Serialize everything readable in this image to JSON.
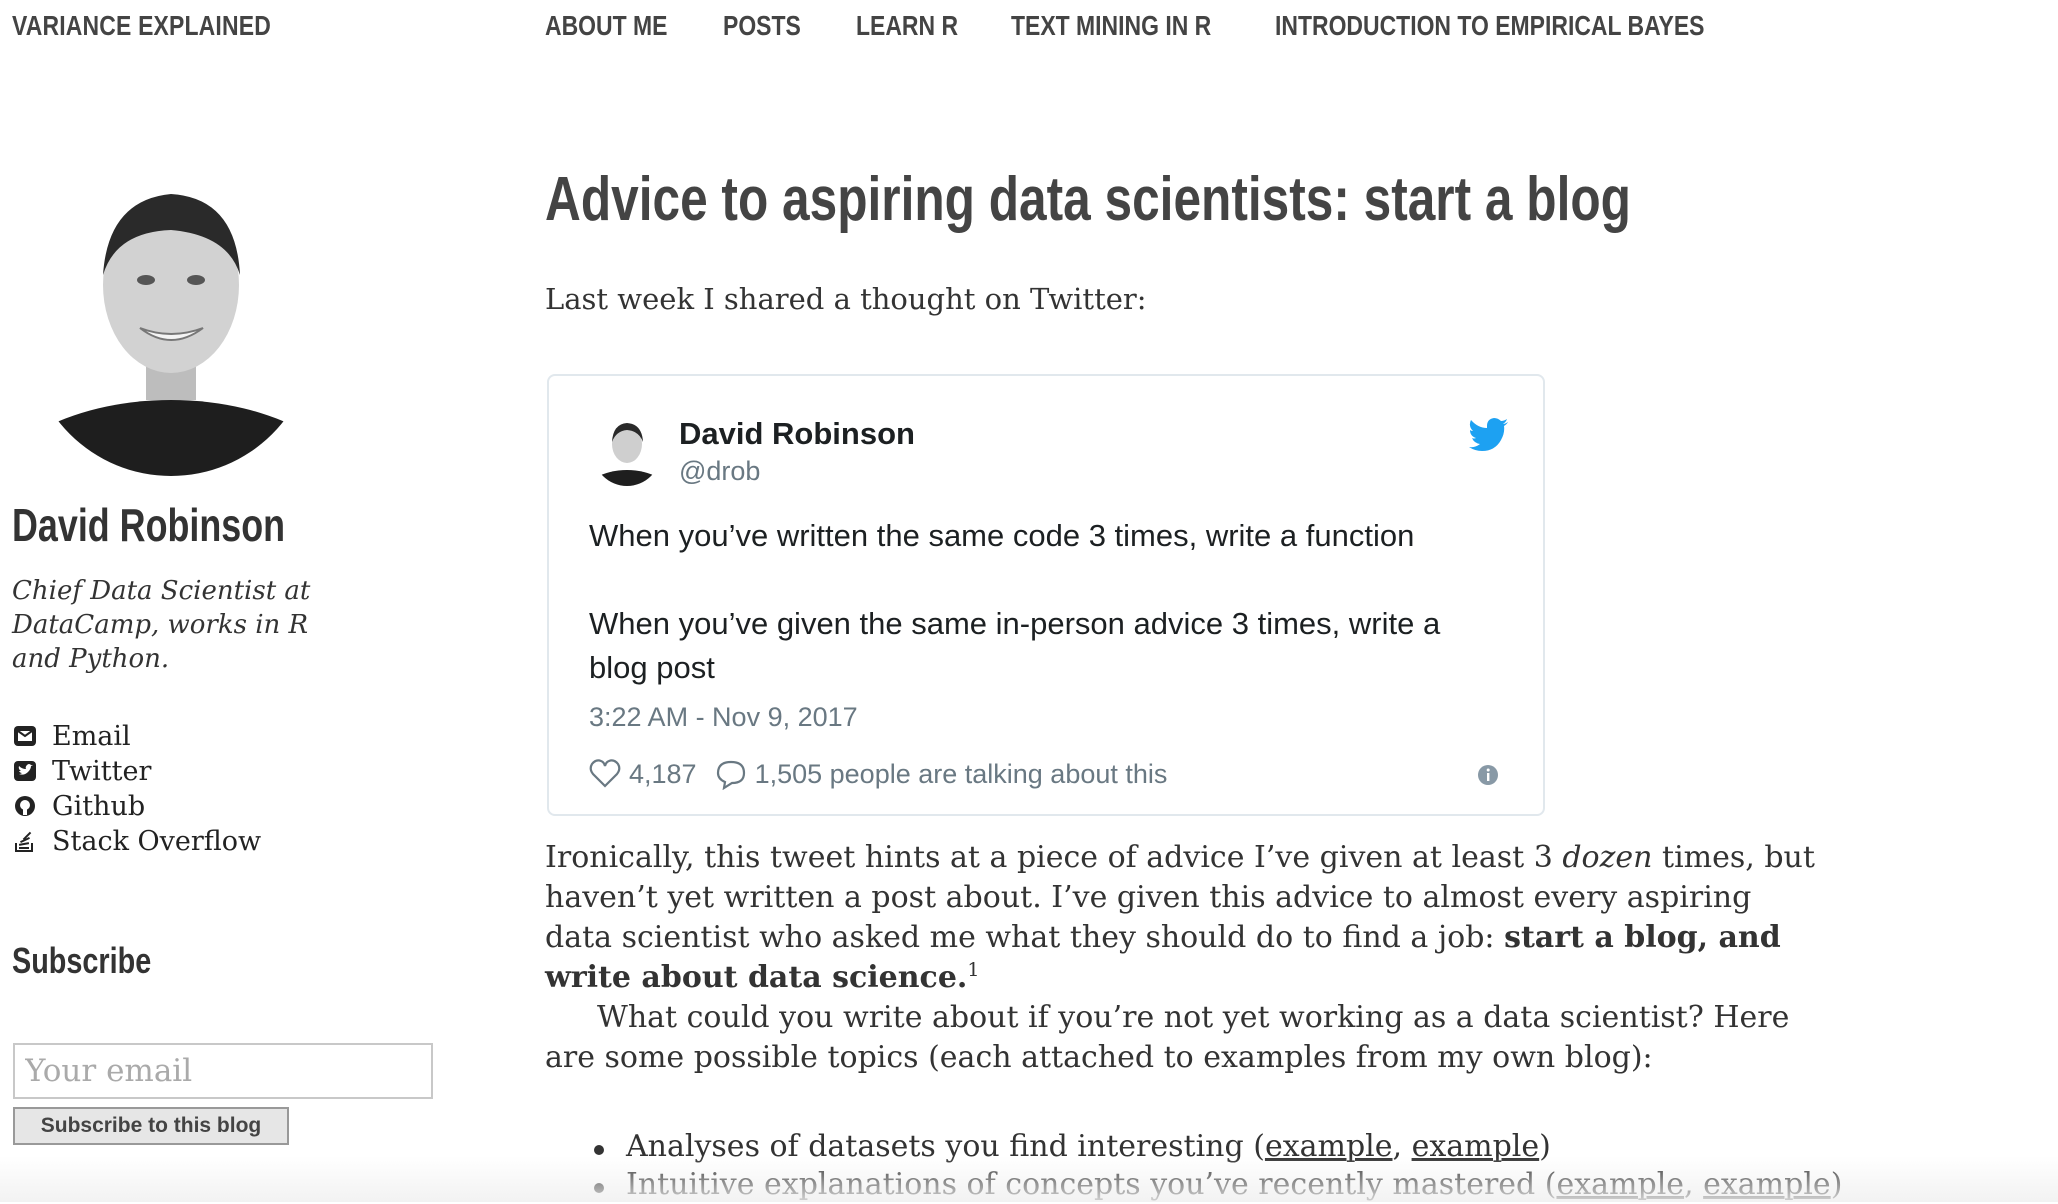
{
  "nav": {
    "brand": "VARIANCE EXPLAINED",
    "links": [
      "ABOUT ME",
      "POSTS",
      "LEARN R",
      "TEXT MINING IN R",
      "INTRODUCTION TO EMPIRICAL BAYES"
    ]
  },
  "sidebar": {
    "name": "David Robinson",
    "bio": "Chief Data Scientist at DataCamp, works in R and Python.",
    "social": [
      {
        "label": "Email",
        "icon": "envelope-icon"
      },
      {
        "label": "Twitter",
        "icon": "twitter-square-icon"
      },
      {
        "label": "Github",
        "icon": "github-icon"
      },
      {
        "label": "Stack Overflow",
        "icon": "stack-overflow-icon"
      }
    ],
    "subscribe": {
      "title": "Subscribe",
      "placeholder": "Your email",
      "button": "Subscribe to this blog"
    }
  },
  "post": {
    "title": "Advice to aspiring data scientists: start a blog",
    "intro": "Last week I shared a thought on Twitter:",
    "tweet": {
      "name": "David Robinson",
      "handle": "@drob",
      "line1": "When you’ve written the same code 3 times, write a function",
      "line2": "When you’ve given the same in-person advice 3 times, write a blog post",
      "time": "3:22 AM - Nov 9, 2017",
      "likes": "4,187",
      "talking": "1,505 people are talking about this",
      "colors": {
        "bird": "#1da1f2",
        "meta": "#697882",
        "text": "#1c2022"
      }
    },
    "para1": {
      "pre": "Ironically, this tweet hints at a piece of advice I’ve given at least 3 ",
      "em": "dozen",
      "mid": " times, but haven’t yet written a post about. I’ve given this advice to almost every aspiring data scientist who asked me what they should do to find a job: ",
      "strong": "start a blog, and write about data science.",
      "footnote": "1"
    },
    "para2": "What could you write about if you’re not yet working as a data scientist? Here are some possible topics (each attached to examples from my own blog):",
    "topics": [
      {
        "text": "Analyses of datasets you find interesting (",
        "links": [
          "example",
          "example"
        ],
        "close": ")"
      },
      {
        "text": "Intuitive explanations of concepts you’ve recently mastered (",
        "links": [
          "example",
          "example"
        ],
        "close": ")"
      }
    ]
  }
}
